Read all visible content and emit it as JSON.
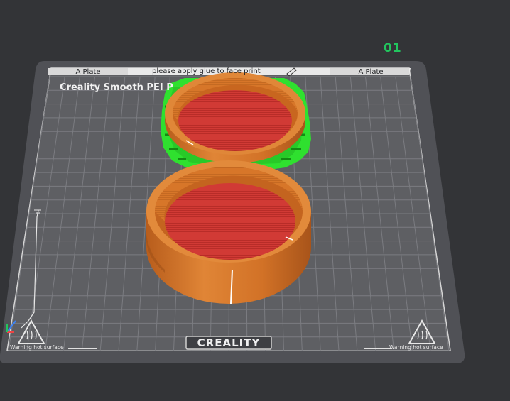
{
  "plate": {
    "number": "01",
    "left_tag": "A Plate",
    "right_tag": "A Plate",
    "center_label": "please apply glue to face print"
  },
  "bed": {
    "title": "Creality Smooth PEI P",
    "brand": "CREALITY",
    "warning_left": "Warning hot surface",
    "warning_right": "Warning hot surface"
  },
  "colors": {
    "background": "#333437",
    "bed_frame": "#505156",
    "bed_surface": "#5d5e62",
    "grid_line": "#7a7b80",
    "plate_number": "#22c55e",
    "part_orange": "#d9782a",
    "part_red": "#d33a34",
    "support_green": "#2ee32e"
  },
  "icons": [
    "hot-surface-warning-icon",
    "axis-gizmo-icon",
    "edit-pencil-icon"
  ]
}
